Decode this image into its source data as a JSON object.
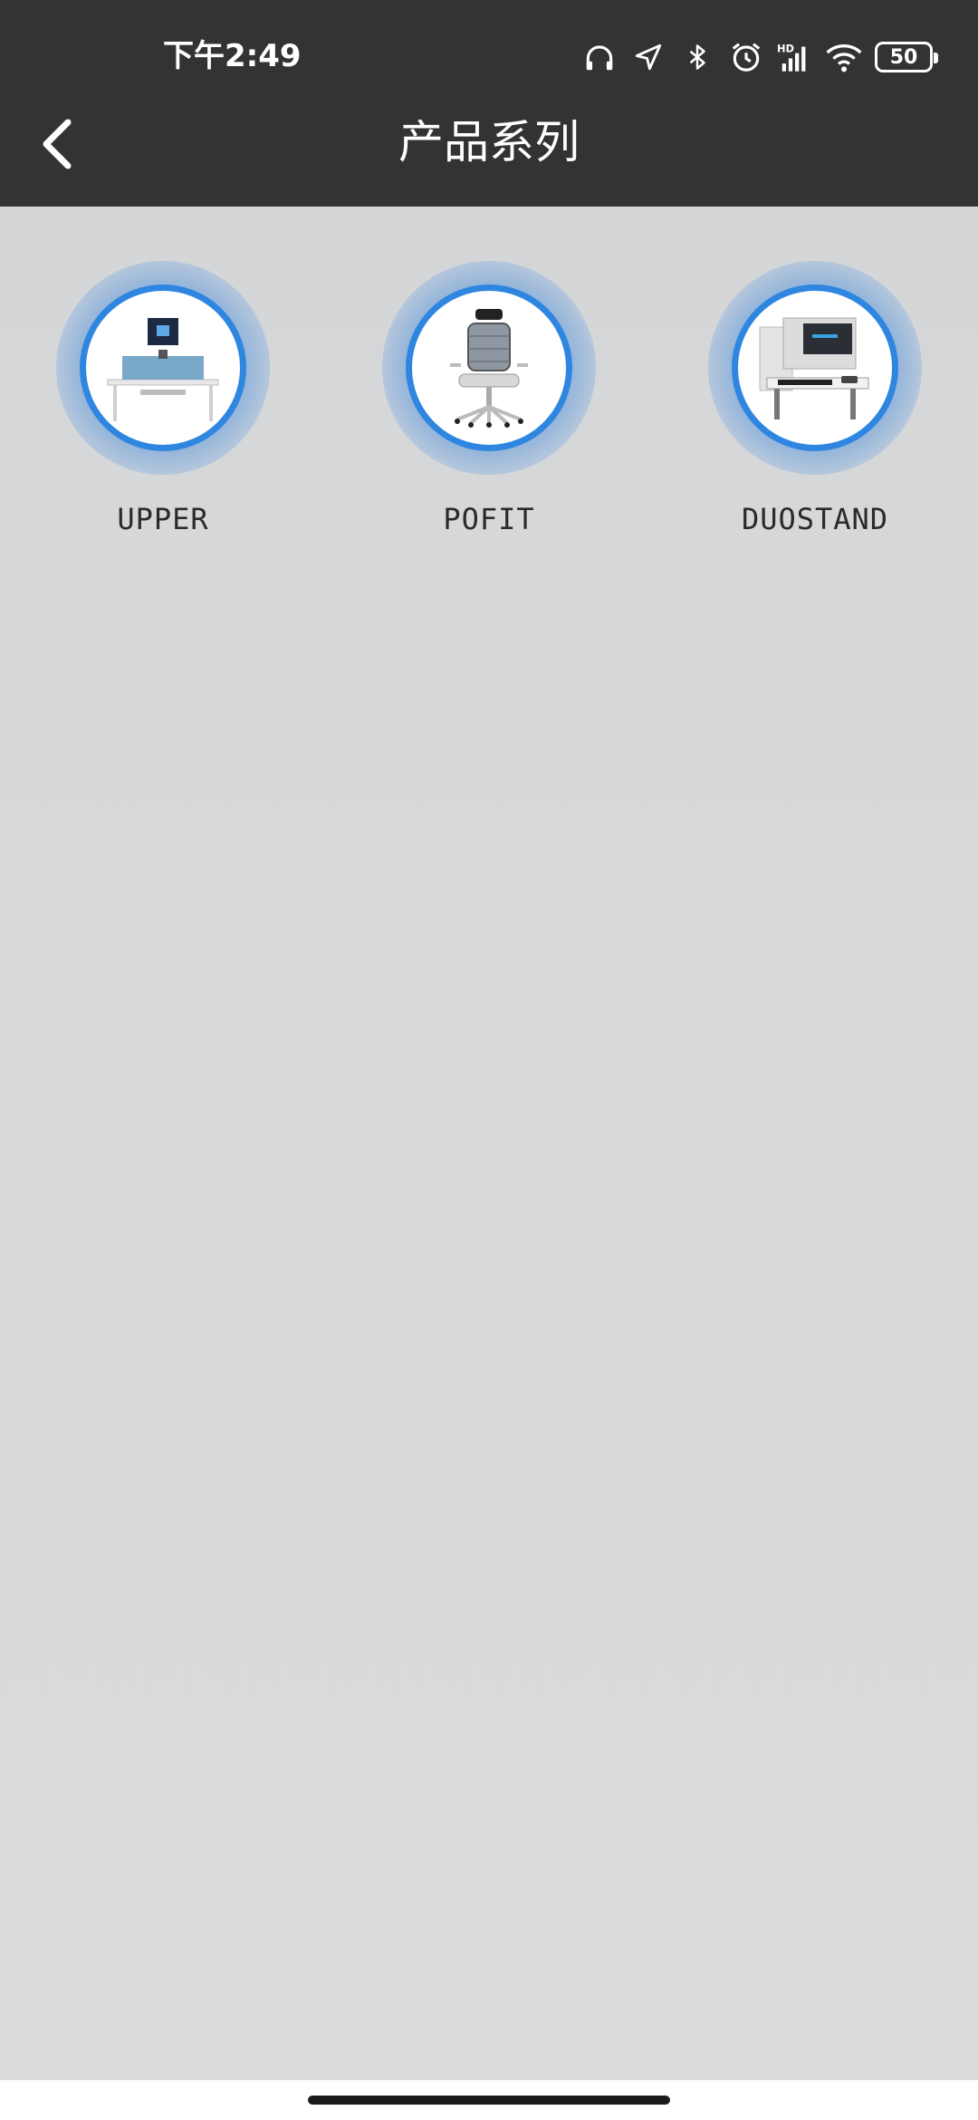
{
  "status_bar": {
    "time": "下午2:49",
    "battery": "50",
    "icons": [
      "headphones-icon",
      "location-icon",
      "bluetooth-icon",
      "alarm-icon",
      "hd-signal-icon",
      "wifi-icon",
      "battery-icon"
    ]
  },
  "header": {
    "title": "产品系列",
    "back_icon": "chevron-left-icon",
    "background": "#333333"
  },
  "products": [
    {
      "label": "UPPER",
      "image": "standing-desk-image"
    },
    {
      "label": "POFIT",
      "image": "office-chair-image"
    },
    {
      "label": "DUOSTAND",
      "image": "desk-converter-image"
    }
  ],
  "colors": {
    "accent_ring": "#2f86e0",
    "page_background": "#d5d7d9"
  }
}
